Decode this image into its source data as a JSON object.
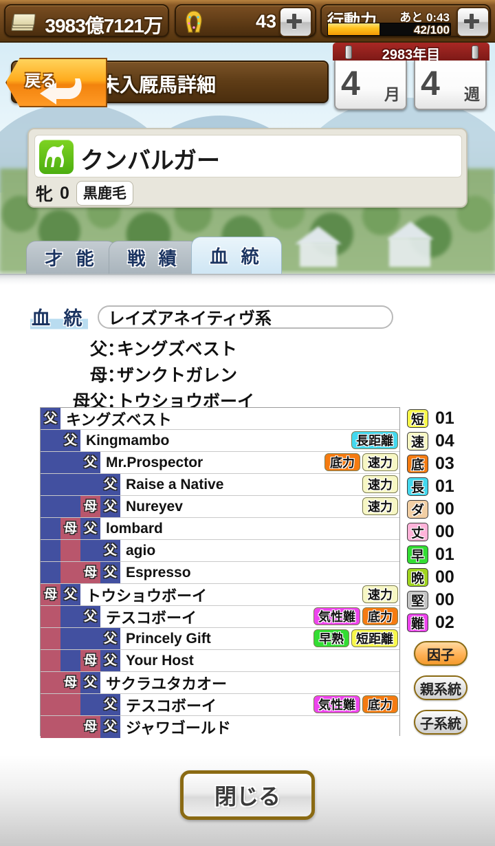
{
  "topbar": {
    "money": {
      "icon": "money-icon",
      "value": "3983億7121万"
    },
    "shoe": {
      "icon": "horseshoe-icon",
      "value": "43",
      "plus_label": "+"
    },
    "action_power": {
      "label": "行動力",
      "timer": "あと 0:43",
      "fraction": "42/100",
      "current": 42,
      "max": 100,
      "plus_label": "+"
    }
  },
  "header": {
    "back_label": "戻る",
    "title": "未入厩馬詳細"
  },
  "date": {
    "year": "2983年目",
    "month_num": "4",
    "month_unit": "月",
    "week_num": "4",
    "week_unit": "週"
  },
  "horse": {
    "icon": "horse-icon",
    "name": "クンバルガー",
    "sex": "牝",
    "age": "0",
    "coat": "黒鹿毛"
  },
  "tabs": [
    {
      "label": "才 能",
      "active": false
    },
    {
      "label": "戦 績",
      "active": false
    },
    {
      "label": "血 統",
      "active": true
    }
  ],
  "pedigree": {
    "section_label": "血 統",
    "line_name": "レイズアネイティヴ系",
    "parents": [
      {
        "key": "父",
        "sep": "：",
        "value": "キングズベスト"
      },
      {
        "key": "母",
        "sep": "：",
        "value": "ザンクトガレン"
      },
      {
        "key": "母父",
        "sep": "：",
        "value": "トウショウボーイ"
      }
    ],
    "rows": [
      {
        "cols": [
          "f"
        ],
        "name": "キングズベスト",
        "jp": true,
        "tags": []
      },
      {
        "cols": [
          "blank-f",
          "f"
        ],
        "name": "Kingmambo",
        "jp": false,
        "tags": [
          {
            "text": "長距離",
            "color": "#44d8ee"
          }
        ]
      },
      {
        "cols": [
          "blank-f",
          "blank-f",
          "f"
        ],
        "name": "Mr.Prospector",
        "jp": false,
        "tags": [
          {
            "text": "底力",
            "color": "#f57b11"
          },
          {
            "text": "速力",
            "color": "#f7f7c4"
          }
        ]
      },
      {
        "cols": [
          "blank-f",
          "blank-f",
          "blank-f",
          "f"
        ],
        "name": "Raise a Native",
        "jp": false,
        "tags": [
          {
            "text": "速力",
            "color": "#f7f7c4"
          }
        ]
      },
      {
        "cols": [
          "blank-f",
          "blank-f",
          "m",
          "f"
        ],
        "name": "Nureyev",
        "jp": false,
        "tags": [
          {
            "text": "速力",
            "color": "#f7f7c4"
          }
        ]
      },
      {
        "cols": [
          "blank-f",
          "m",
          "f"
        ],
        "name": "lombard",
        "jp": false,
        "tags": []
      },
      {
        "cols": [
          "blank-f",
          "blank-m",
          "blank-f",
          "f"
        ],
        "name": "agio",
        "jp": false,
        "tags": []
      },
      {
        "cols": [
          "blank-f",
          "blank-m",
          "m",
          "f"
        ],
        "name": "Espresso",
        "jp": false,
        "tags": []
      },
      {
        "cols": [
          "m",
          "f"
        ],
        "name": "トウショウボーイ",
        "jp": true,
        "tags": [
          {
            "text": "速力",
            "color": "#f7f7c4"
          }
        ]
      },
      {
        "cols": [
          "blank-m",
          "blank-f",
          "f"
        ],
        "name": "テスコボーイ",
        "jp": true,
        "tags": [
          {
            "text": "気性難",
            "color": "#ee44ee"
          },
          {
            "text": "底力",
            "color": "#f57b11"
          }
        ]
      },
      {
        "cols": [
          "blank-m",
          "blank-f",
          "blank-f",
          "f"
        ],
        "name": "Princely Gift",
        "jp": false,
        "tags": [
          {
            "text": "早熟",
            "color": "#33dd33"
          },
          {
            "text": "短距離",
            "color": "#f8f84a"
          }
        ]
      },
      {
        "cols": [
          "blank-m",
          "blank-f",
          "m",
          "f"
        ],
        "name": "Your Host",
        "jp": false,
        "tags": []
      },
      {
        "cols": [
          "blank-m",
          "m",
          "f"
        ],
        "name": "サクラユタカオー",
        "jp": true,
        "tags": []
      },
      {
        "cols": [
          "blank-m",
          "blank-m",
          "blank-f",
          "f"
        ],
        "name": "テスコボーイ",
        "jp": true,
        "tags": [
          {
            "text": "気性難",
            "color": "#ee44ee"
          },
          {
            "text": "底力",
            "color": "#f57b11"
          }
        ]
      },
      {
        "cols": [
          "blank-m",
          "blank-m",
          "m",
          "f"
        ],
        "name": "ジャワゴールド",
        "jp": true,
        "tags": []
      }
    ],
    "glyph_father": "父",
    "glyph_mother": "母"
  },
  "stats": [
    {
      "label": "短",
      "value": "01",
      "color": "#f8f84a"
    },
    {
      "label": "速",
      "value": "04",
      "color": "#f7f7c4"
    },
    {
      "label": "底",
      "value": "03",
      "color": "#f57b11"
    },
    {
      "label": "長",
      "value": "01",
      "color": "#44d8ee"
    },
    {
      "label": "ダ",
      "value": "00",
      "color": "#f2cfa4"
    },
    {
      "label": "丈",
      "value": "00",
      "color": "#ffb3d9"
    },
    {
      "label": "早",
      "value": "01",
      "color": "#33dd33"
    },
    {
      "label": "晩",
      "value": "00",
      "color": "#9fd41e"
    },
    {
      "label": "堅",
      "value": "00",
      "color": "#c4c4c4"
    },
    {
      "label": "難",
      "value": "02",
      "color": "#ee44ee"
    }
  ],
  "side_buttons": [
    {
      "label": "因子",
      "highlight": true
    },
    {
      "label": "親系統",
      "highlight": false
    },
    {
      "label": "子系統",
      "highlight": false
    }
  ],
  "footer": {
    "close_label": "閉じる"
  }
}
